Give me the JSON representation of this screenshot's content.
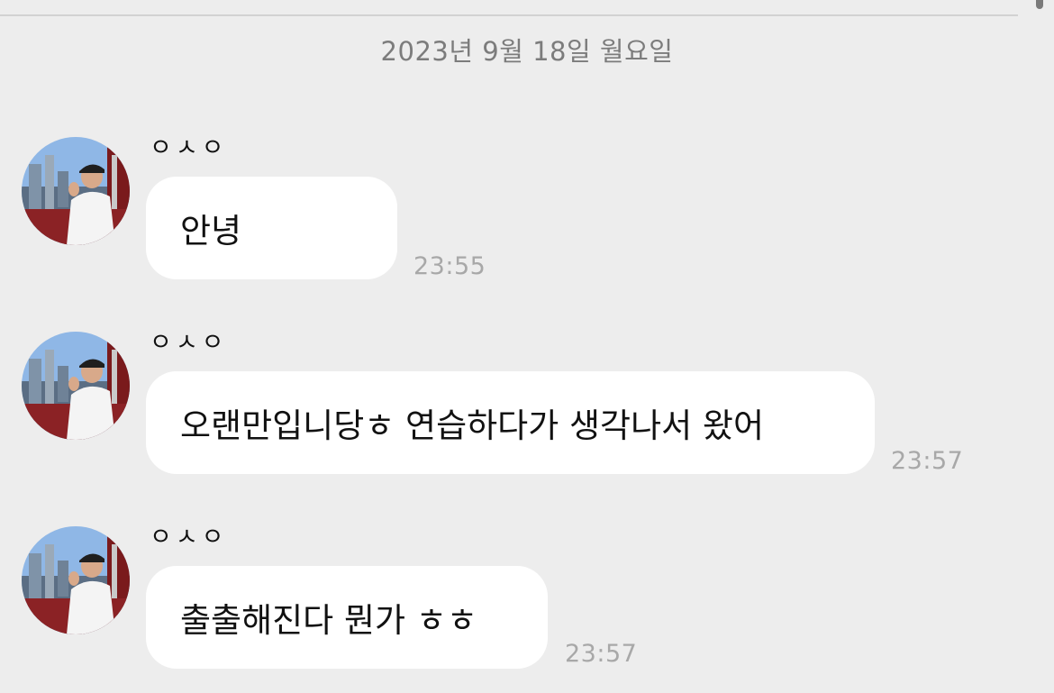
{
  "date_separator": "2023년 9월 18일 월요일",
  "messages": [
    {
      "sender": "ㅇㅅㅇ",
      "text": "안녕",
      "time": "23:55"
    },
    {
      "sender": "ㅇㅅㅇ",
      "text": "오랜만입니당ㅎ 연습하다가 생각나서 왔어",
      "time": "23:57"
    },
    {
      "sender": "ㅇㅅㅇ",
      "text": "출출해진다 뭔가 ㅎㅎ",
      "time": "23:57"
    }
  ],
  "icons": {
    "avatar": "profile-photo-icon"
  },
  "colors": {
    "background": "#ededed",
    "bubble": "#ffffff",
    "time": "#a8a8a8",
    "date": "#7c7c7c"
  }
}
